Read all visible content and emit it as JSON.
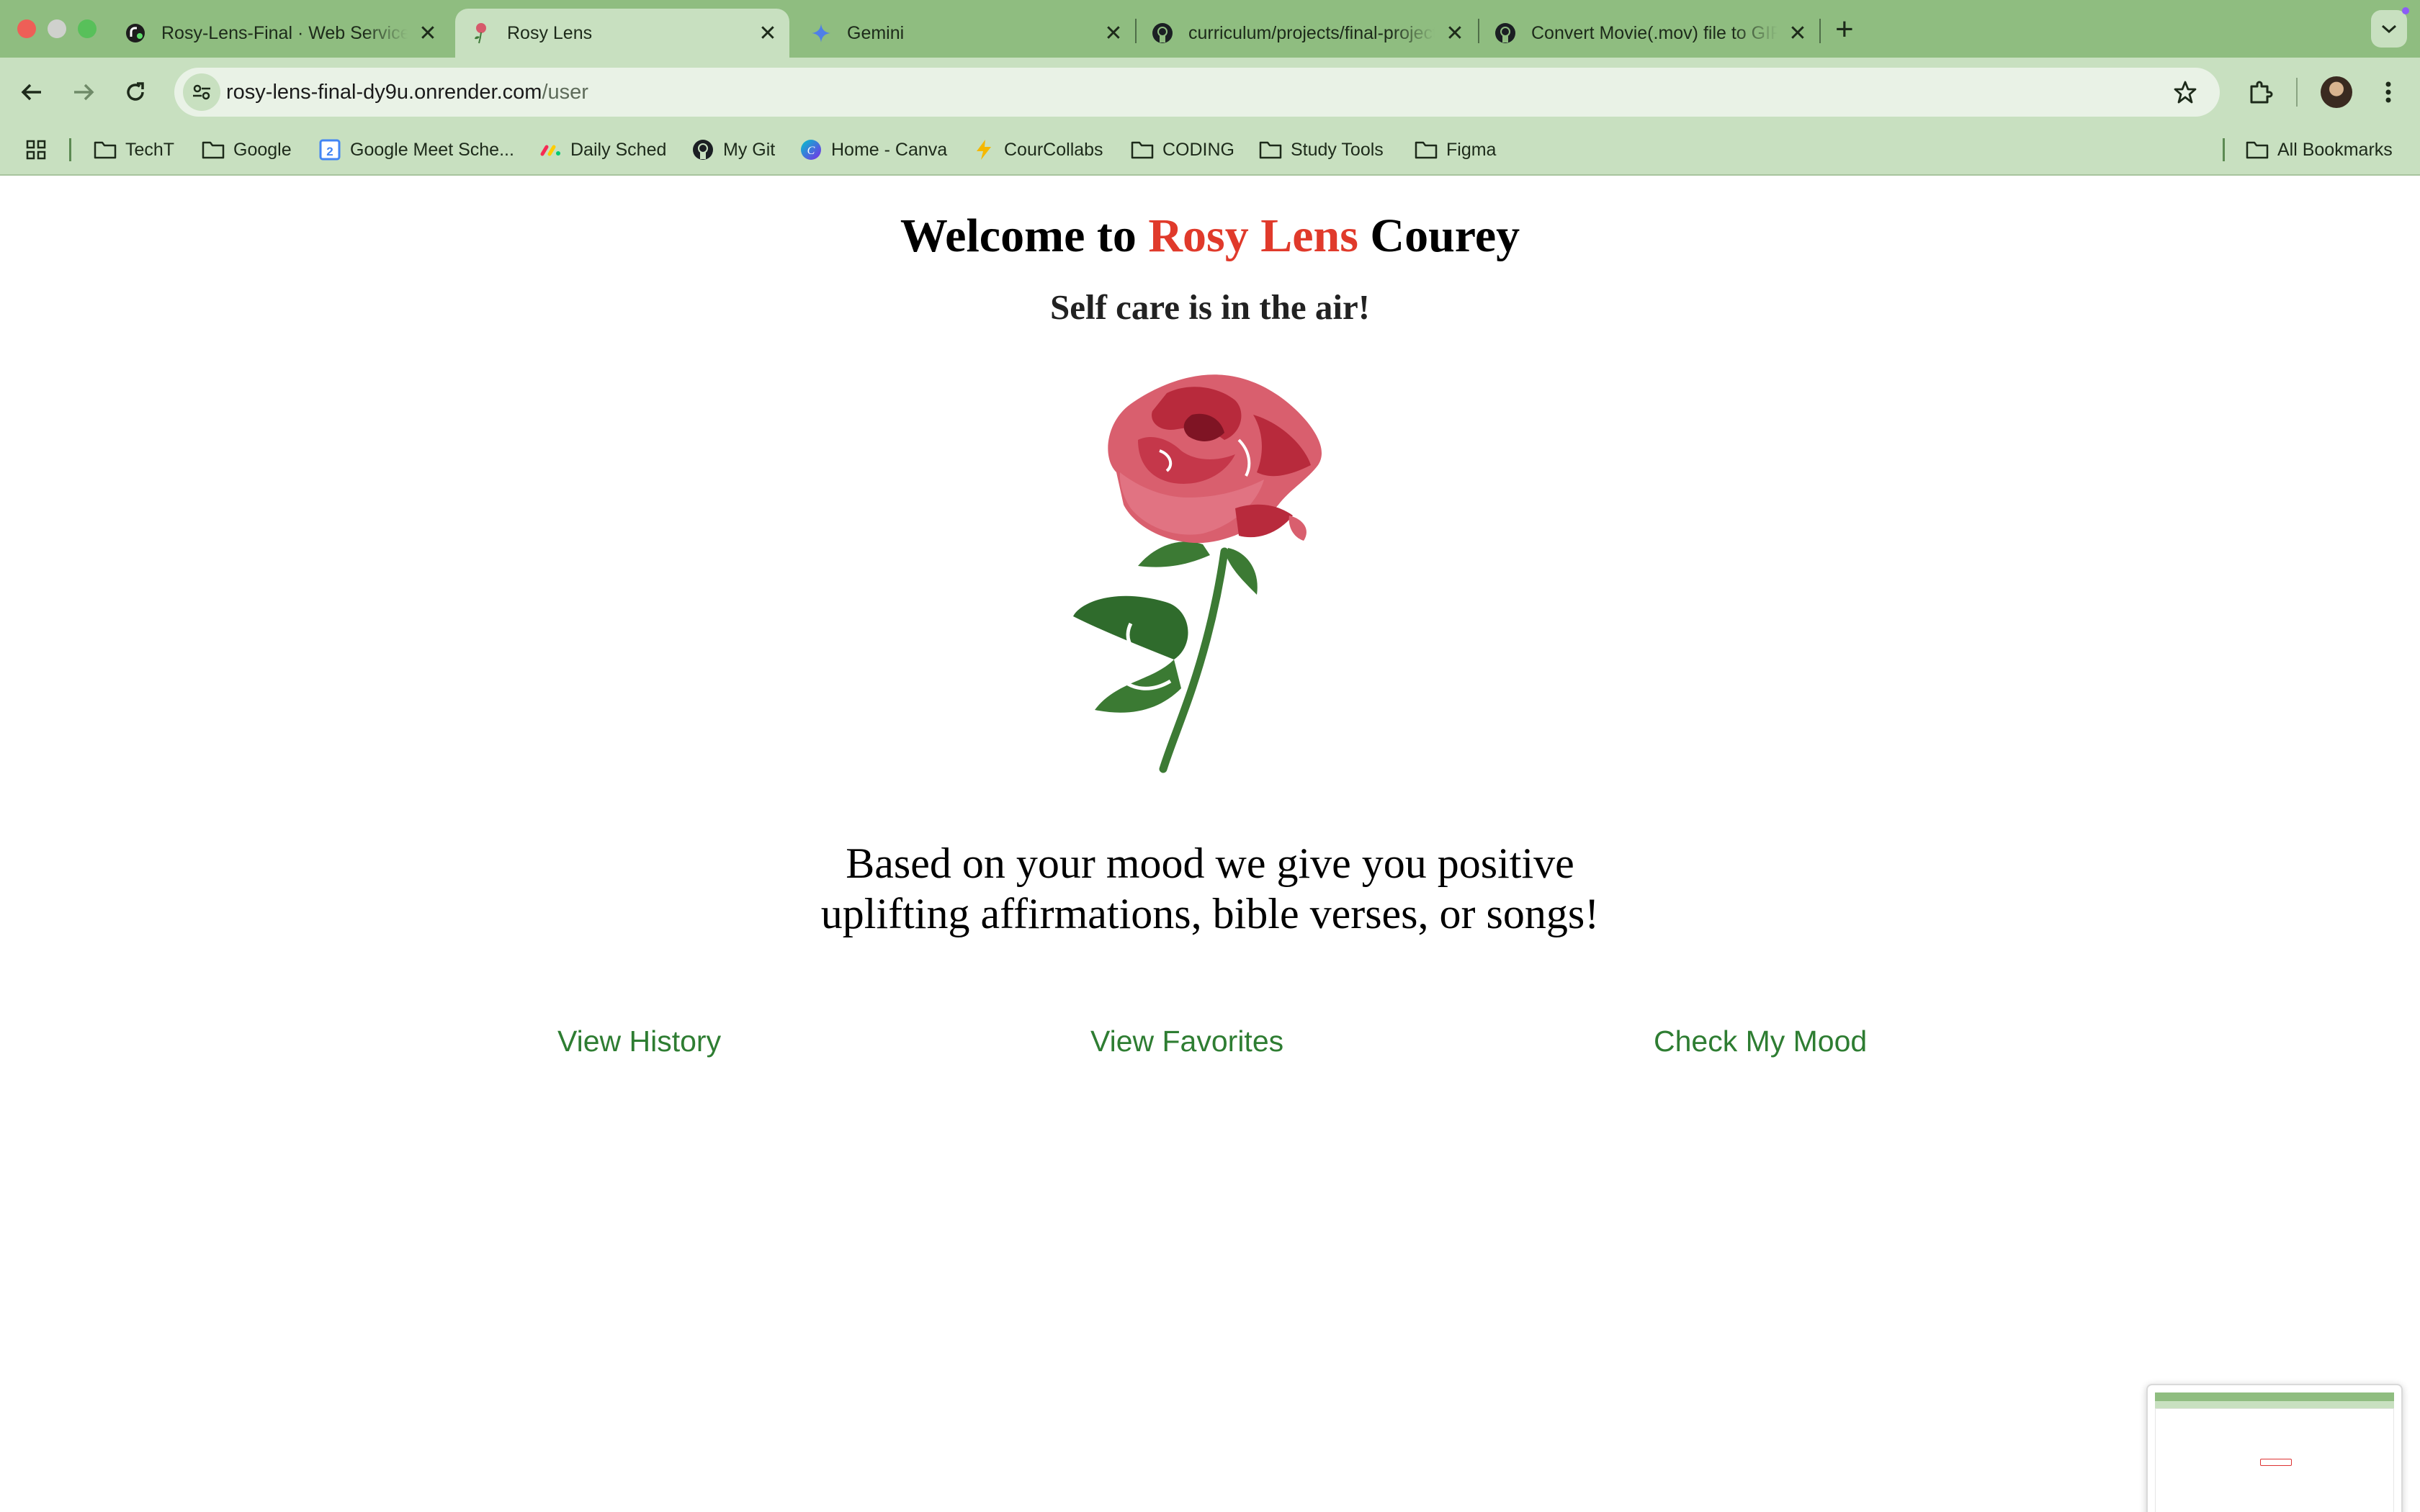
{
  "browser": {
    "tabs": [
      {
        "title": "Rosy-Lens-Final · Web Service",
        "icon": "render-icon",
        "active": false
      },
      {
        "title": "Rosy Lens",
        "icon": "rose-favicon",
        "active": true
      },
      {
        "title": "Gemini",
        "icon": "gemini-icon",
        "active": false
      },
      {
        "title": "curriculum/projects/final-project",
        "icon": "github-icon",
        "active": false
      },
      {
        "title": "Convert Movie(.mov) file to GIF",
        "icon": "github-icon",
        "active": false
      }
    ],
    "close_glyph": "✕",
    "new_tab_glyph": "+",
    "url_host": "rosy-lens-final-dy9u.onrender.com",
    "url_path": "/user",
    "bookmarks": [
      {
        "label": "TechT",
        "icon": "folder-icon"
      },
      {
        "label": "Google",
        "icon": "folder-icon"
      },
      {
        "label": "Google Meet Sche...",
        "icon": "calendar-icon"
      },
      {
        "label": "Daily Sched",
        "icon": "monday-icon"
      },
      {
        "label": "My Git",
        "icon": "github-icon"
      },
      {
        "label": "Home - Canva",
        "icon": "canva-icon"
      },
      {
        "label": "CourCollabs",
        "icon": "bolt-icon"
      },
      {
        "label": "CODING",
        "icon": "folder-icon"
      },
      {
        "label": "Study Tools",
        "icon": "folder-icon"
      },
      {
        "label": "Figma",
        "icon": "folder-icon"
      }
    ],
    "all_bookmarks": "All Bookmarks"
  },
  "page": {
    "welcome_prefix": "Welcome to",
    "brand": "Rosy Lens",
    "user_name": "Courey",
    "subtitle": "Self care is in the air!",
    "description_line1": "Based on your mood we give you positive",
    "description_line2": "uplifting affirmations, bible verses, or songs!",
    "links": {
      "history": "View History",
      "favorites": "View Favorites",
      "mood": "Check My Mood"
    }
  },
  "colors": {
    "brand_red": "#e03a2b",
    "link_green": "#2e7d32",
    "chrome_green": "#8fbd80"
  }
}
